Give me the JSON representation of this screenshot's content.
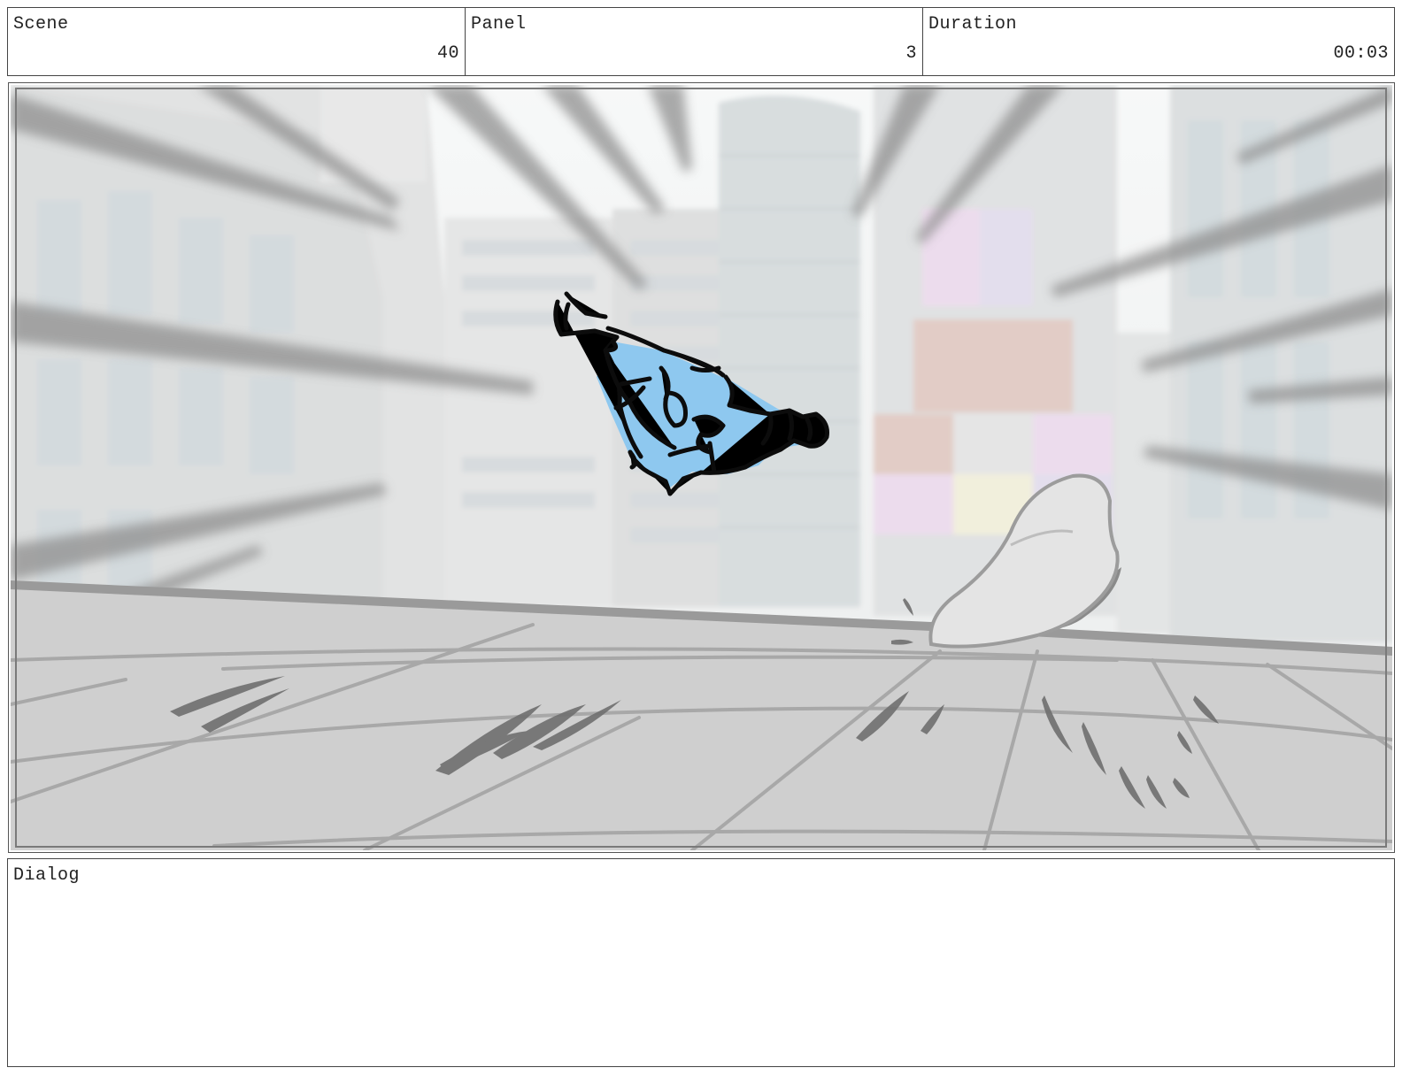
{
  "header": {
    "scene": {
      "label": "Scene",
      "value": "40"
    },
    "panel": {
      "label": "Panel",
      "value": "3"
    },
    "duration": {
      "label": "Duration",
      "value": "00:03"
    }
  },
  "artwork": {
    "description_icon": "storyboard-sketch-icon",
    "character_color": "#8ec8ef",
    "rock_color": "#e4e4e4",
    "ground_color": "#cfcfcf",
    "building_color": "#dcdcdc",
    "billboard_colors": [
      "#d7b9b0",
      "#e5cfe6",
      "#ece9cf",
      "#d9d2e6"
    ]
  },
  "dialog": {
    "label": "Dialog",
    "text": ""
  }
}
